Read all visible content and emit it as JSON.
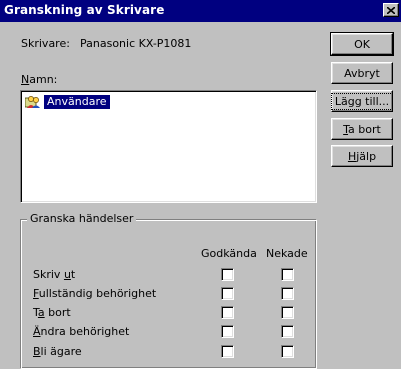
{
  "window": {
    "title": "Granskning av Skrivare",
    "close_glyph": "✕"
  },
  "printer": {
    "label": "Skrivare:",
    "name": "Panasonic KX-P1081"
  },
  "names": {
    "label_prefix": "N",
    "label_rest": "amn:",
    "items": [
      {
        "label": "Användare",
        "icon": "users-group-icon",
        "selected": true
      }
    ]
  },
  "buttons": {
    "ok": "OK",
    "cancel": "Avbryt",
    "add": "Lägg till...",
    "remove_prefix": "T",
    "remove_rest": "a bort",
    "help_prefix": "H",
    "help_rest": "jälp"
  },
  "audit": {
    "group_title": "Granska händelser",
    "col_success": "Godkända",
    "col_failure": "Nekade",
    "rows": [
      {
        "pre": "Skriv ",
        "key": "u",
        "post": "t",
        "success": false,
        "failure": false
      },
      {
        "pre": "",
        "key": "F",
        "post": "ullständig behörighet",
        "success": false,
        "failure": false
      },
      {
        "pre": "T",
        "key": "a",
        "post": " bort",
        "success": false,
        "failure": false
      },
      {
        "pre": "",
        "key": "Ä",
        "post": "ndra behörighet",
        "success": false,
        "failure": false
      },
      {
        "pre": "",
        "key": "B",
        "post": "li ägare",
        "success": false,
        "failure": false
      }
    ]
  },
  "colors": {
    "titlebar": "#000080",
    "face": "#c0c0c0",
    "selection": "#000080"
  }
}
